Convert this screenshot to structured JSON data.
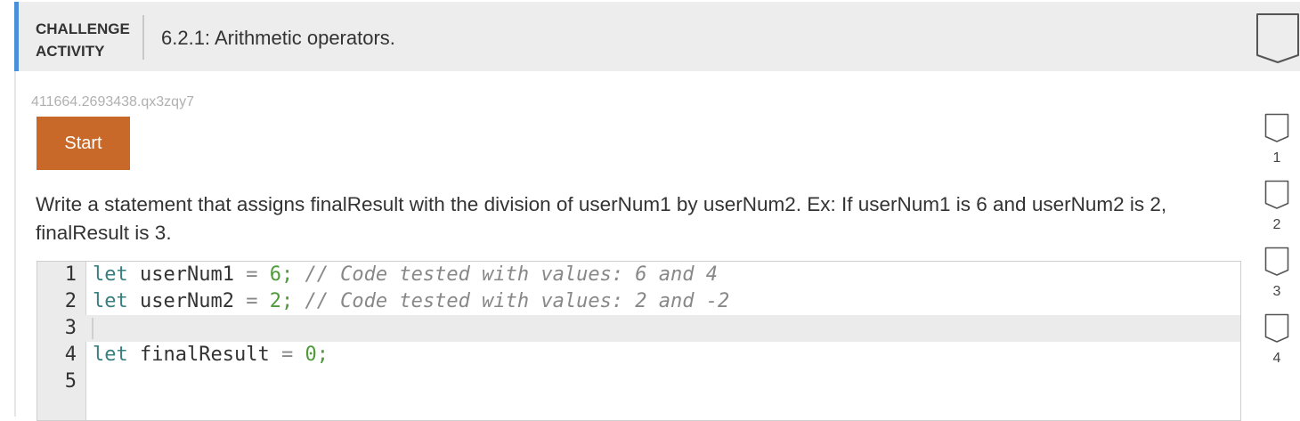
{
  "header": {
    "activity_type_line1": "CHALLENGE",
    "activity_type_line2": "ACTIVITY",
    "title": "6.2.1: Arithmetic operators.",
    "accent_color": "#4a90d9"
  },
  "activity": {
    "id": "411664.2693438.qx3zqy7",
    "start_label": "Start",
    "start_color": "#c8692a",
    "prompt": "Write a statement that assigns finalResult with the division of userNum1 by userNum2. Ex: If userNum1 is 6 and userNum2 is 2, finalResult is 3."
  },
  "editor": {
    "lines": [
      {
        "num": "1",
        "kw": "let",
        "name": " userNum1 ",
        "op": "=",
        "sp": " ",
        "val": "6",
        "semi": ";",
        "comment": " // Code tested with values: 6 and 4"
      },
      {
        "num": "2",
        "kw": "let",
        "name": " userNum2 ",
        "op": "=",
        "sp": " ",
        "val": "2",
        "semi": ";",
        "comment": " // Code tested with values: 2 and -2"
      },
      {
        "num": "3"
      },
      {
        "num": "4",
        "kw": "let",
        "name": " finalResult ",
        "op": "=",
        "sp": " ",
        "val": "0",
        "semi": ";"
      },
      {
        "num": "5"
      }
    ]
  },
  "levels": [
    {
      "label": "1"
    },
    {
      "label": "2"
    },
    {
      "label": "3"
    },
    {
      "label": "4"
    }
  ]
}
